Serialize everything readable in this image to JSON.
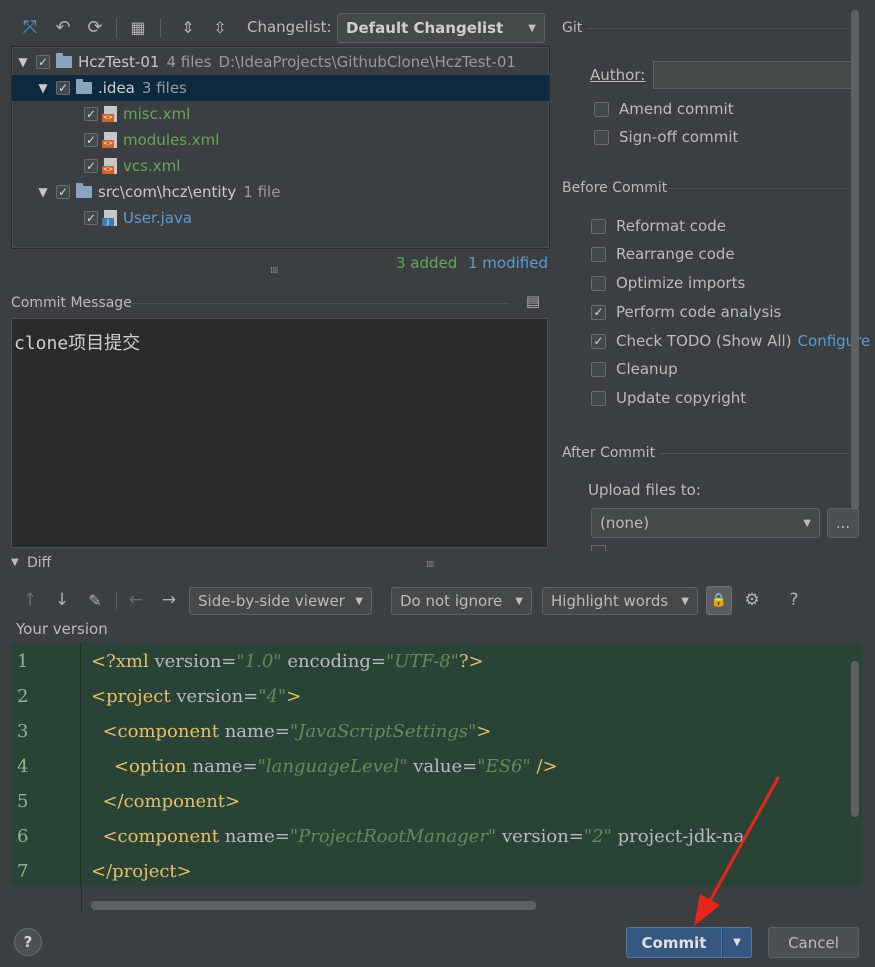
{
  "toolbar": {
    "changelist_label": "Changelist:",
    "changelist_value": "Default Changelist"
  },
  "tree": {
    "root": {
      "name": "HczTest-01",
      "count": "4 files",
      "path": "D:\\IdeaProjects\\GithubClone\\HczTest-01"
    },
    "idea": {
      "name": ".idea",
      "count": "3 files"
    },
    "files_idea": [
      "misc.xml",
      "modules.xml",
      "vcs.xml"
    ],
    "src": {
      "name": "src\\com\\hcz\\entity",
      "count": "1 file"
    },
    "files_src": [
      "User.java"
    ]
  },
  "summary": {
    "added": "3 added",
    "modified": "1 modified"
  },
  "commit_message": {
    "label": "Commit Message",
    "text": "clone项目提交"
  },
  "git": {
    "title": "Git",
    "author_label": "Author:",
    "author_value": "",
    "options": [
      {
        "label": "Amend commit",
        "checked": false
      },
      {
        "label": "Sign-off commit",
        "checked": false
      }
    ]
  },
  "before_commit": {
    "title": "Before Commit",
    "options": [
      {
        "label": "Reformat code",
        "checked": false
      },
      {
        "label": "Rearrange code",
        "checked": false
      },
      {
        "label": "Optimize imports",
        "checked": false
      },
      {
        "label": "Perform code analysis",
        "checked": true
      },
      {
        "label": "Check TODO (Show All)",
        "checked": true,
        "link": "Configure"
      },
      {
        "label": "Cleanup",
        "checked": false
      },
      {
        "label": "Update copyright",
        "checked": false
      }
    ]
  },
  "after_commit": {
    "title": "After Commit",
    "upload_label": "Upload files to:",
    "upload_value": "(none)",
    "browse": "..."
  },
  "diff": {
    "title": "Diff",
    "viewer": "Side-by-side viewer",
    "ignore": "Do not ignore",
    "highlight": "Highlight words",
    "help": "?",
    "your_version": "Your version",
    "line_numbers": [
      "1",
      "2",
      "3",
      "4",
      "5",
      "6",
      "7"
    ]
  },
  "footer": {
    "help": "?",
    "commit": "Commit",
    "cancel": "Cancel"
  },
  "colors": {
    "background": "#3c3f41",
    "selection": "#0d293e",
    "added_green": "#62a85a",
    "modified_blue": "#5a9bd5",
    "commit_button": "#365880",
    "annotation_arrow": "#e8241c"
  }
}
